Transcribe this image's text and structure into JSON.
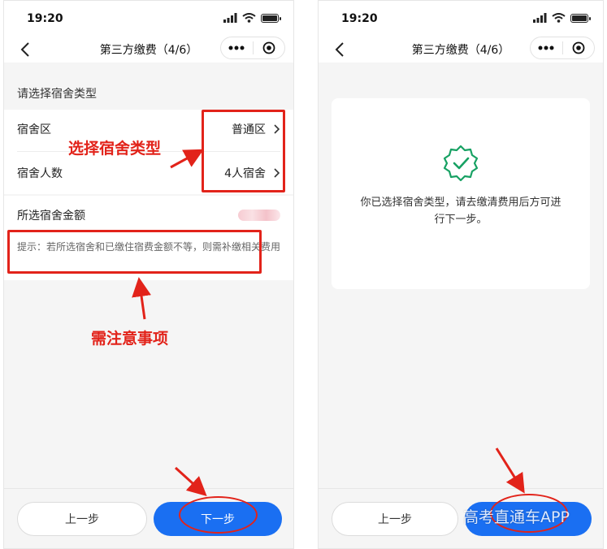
{
  "status_bar": {
    "time": "19:20"
  },
  "navbar": {
    "title": "第三方缴费（4/6）"
  },
  "left": {
    "section_title": "请选择宿舍类型",
    "rows": [
      {
        "label": "宿舍区",
        "value": "普通区"
      },
      {
        "label": "宿舍人数",
        "value": "4人宿舍"
      }
    ],
    "amount_label": "所选宿舍金额",
    "tip": "提示：若所选宿舍和已缴住宿费金额不等，则需补缴相关费用",
    "prev_button": "上一步",
    "next_button": "下一步"
  },
  "right": {
    "message": "你已选择宿舍类型，请去缴清费用后方可进行下一步。",
    "prev_button": "上一步"
  },
  "annotations": {
    "select_type": "选择宿舍类型",
    "notice": "需注意事项",
    "color": "#e2231a"
  },
  "watermark": "高考直通车APP",
  "colors": {
    "primary": "#1a6ff2",
    "success": "#17a163"
  }
}
